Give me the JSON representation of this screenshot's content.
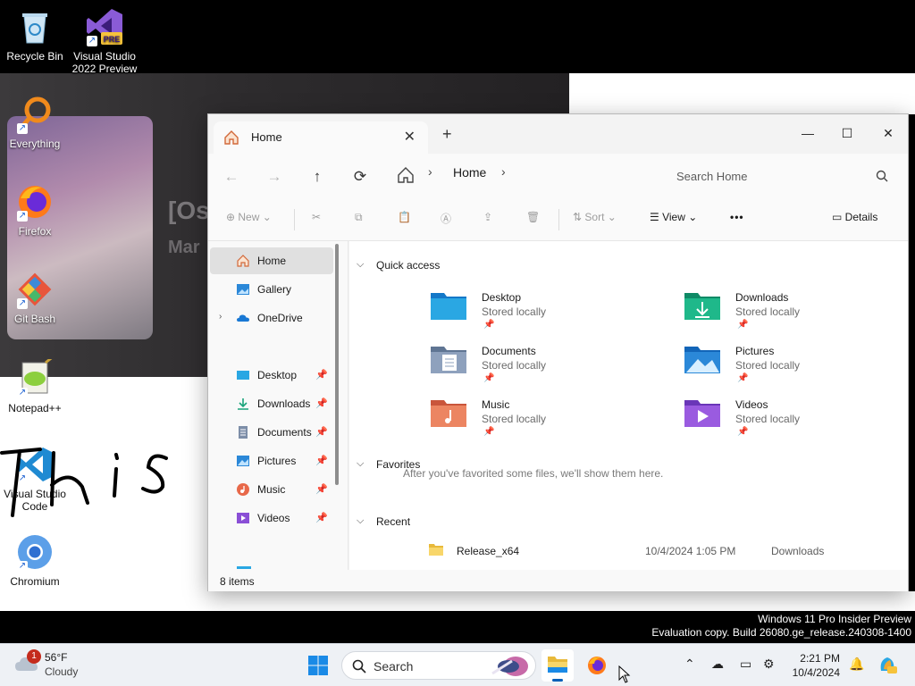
{
  "desktop": {
    "icons": [
      {
        "label": "Recycle Bin"
      },
      {
        "label": "Visual Studio 2022 Preview",
        "line1": "Visual Studio",
        "line2": "2022 Preview",
        "badge": "PRE"
      },
      {
        "label": "Everything"
      },
      {
        "label": "Firefox"
      },
      {
        "label": "Git Bash"
      },
      {
        "label": "Notepad++"
      },
      {
        "label": "Visual Studio Code",
        "line1": "Visual Studio",
        "line2": "Code"
      },
      {
        "label": "Chromium"
      }
    ],
    "wallpaper_title": "[Os",
    "wallpaper_sub": "Mar",
    "watermark_line1": "Windows 11 Pro Insider Preview",
    "watermark_line2": "Evaluation copy. Build 26080.ge_release.240308-1400"
  },
  "explorer": {
    "tab_label": "Home",
    "new_tab": "+",
    "close_tab": "✕",
    "window_controls": {
      "minimize": "—",
      "maximize": "☐",
      "close": "✕"
    },
    "breadcrumb": "Home",
    "search_placeholder": "Search Home",
    "commands": {
      "new": "New",
      "sort": "Sort",
      "view": "View",
      "more": "•••",
      "details": "Details"
    },
    "nav": [
      {
        "label": "Home"
      },
      {
        "label": "Gallery"
      },
      {
        "label": "OneDrive"
      },
      {
        "label": "Desktop"
      },
      {
        "label": "Downloads"
      },
      {
        "label": "Documents"
      },
      {
        "label": "Pictures"
      },
      {
        "label": "Music"
      },
      {
        "label": "Videos"
      }
    ],
    "quick_access_title": "Quick access",
    "quick_access": [
      {
        "name": "Desktop",
        "sub": "Stored locally"
      },
      {
        "name": "Downloads",
        "sub": "Stored locally"
      },
      {
        "name": "Documents",
        "sub": "Stored locally"
      },
      {
        "name": "Pictures",
        "sub": "Stored locally"
      },
      {
        "name": "Music",
        "sub": "Stored locally"
      },
      {
        "name": "Videos",
        "sub": "Stored locally"
      }
    ],
    "favorites_title": "Favorites",
    "favorites_message": "After you've favorited some files, we'll show them here.",
    "recent_title": "Recent",
    "recent": [
      {
        "name": "Release_x64",
        "date": "10/4/2024 1:05 PM",
        "location": "Downloads"
      }
    ],
    "status": "8 items"
  },
  "taskbar": {
    "weather_temp": "56°F",
    "weather_cond": "Cloudy",
    "weather_badge": "1",
    "search_label": "Search",
    "time": "2:21 PM",
    "date": "10/4/2024"
  },
  "colors": {
    "accent": "#005fb8",
    "folder_blue": "#1e88e5",
    "folder_green": "#1aa37a"
  }
}
